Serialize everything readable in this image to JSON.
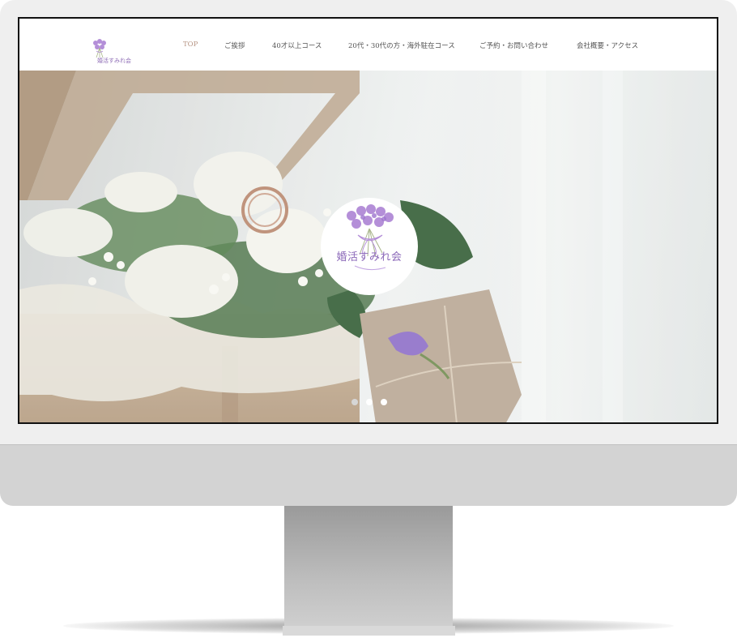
{
  "site": {
    "logo_text": "婚活すみれ会",
    "emblem_text": "婚活すみれ会"
  },
  "nav": {
    "items": [
      {
        "label": "TOP",
        "active": true
      },
      {
        "label": "ご挨拶",
        "active": false
      },
      {
        "label": "40才以上コース",
        "active": false
      },
      {
        "label": "20代・30代の方・海外駐在コース",
        "active": false
      },
      {
        "label": "ご予約・お問い合わせ",
        "active": false
      },
      {
        "label": "会社概要・アクセス",
        "active": false
      }
    ]
  },
  "slider": {
    "slide_count": 3,
    "current_slide": 2
  },
  "colors": {
    "brand_purple": "#8a67b8",
    "nav_active": "#b79584",
    "nav_text": "#555555"
  }
}
